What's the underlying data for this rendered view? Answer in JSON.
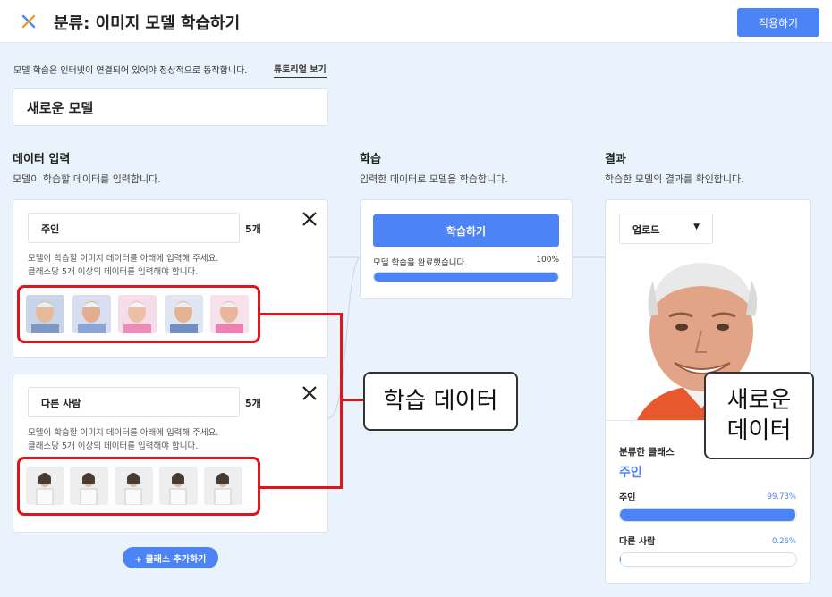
{
  "header": {
    "title": "분류: 이미지 모델 학습하기",
    "apply_label": "적용하기"
  },
  "notice": {
    "text": "모델 학습은 인터넷이 연결되어 있어야 정상적으로 동작합니다.",
    "tutorial_label": "튜토리얼 보기"
  },
  "model_name": "새로운 모델",
  "columns": {
    "input": {
      "title": "데이터 입력",
      "desc": "모델이 학습할 데이터를 입력합니다."
    },
    "train": {
      "title": "학습",
      "desc": "입력한 데이터로 모델을 학습합니다."
    },
    "result": {
      "title": "결과",
      "desc": "학습한 모델의 결과를 확인합니다."
    }
  },
  "classes": [
    {
      "name": "주인",
      "count": "5개",
      "hint1": "모델이 학습할 이미지 데이터를 아래에 입력해 주세요.",
      "hint2": "클래스당 5개 이상의 데이터를 입력해야 합니다."
    },
    {
      "name": "다른 사람",
      "count": "5개",
      "hint1": "모델이 학습할 이미지 데이터를 아래에 입력해 주세요.",
      "hint2": "클래스당 5개 이상의 데이터를 입력해야 합니다."
    }
  ],
  "add_class_label": "+ 클래스 추가하기",
  "training": {
    "button_label": "학습하기",
    "status": "모델 학습을 완료했습니다.",
    "percent_text": "100%",
    "progress": 1.0
  },
  "result": {
    "dropdown_value": "업로드",
    "classified_label": "분류한 클래스",
    "classified_value": "주인",
    "scores": [
      {
        "label": "주인",
        "value_text": "99.73%",
        "value": 0.9973
      },
      {
        "label": "다른 사람",
        "value_text": "0.26%",
        "value": 0.0026
      }
    ]
  },
  "callouts": {
    "training_data": "학습 데이터",
    "new_data_line1": "새로운",
    "new_data_line2": "데이터"
  },
  "colors": {
    "accent": "#4d84f5",
    "highlight": "#e0141b"
  }
}
